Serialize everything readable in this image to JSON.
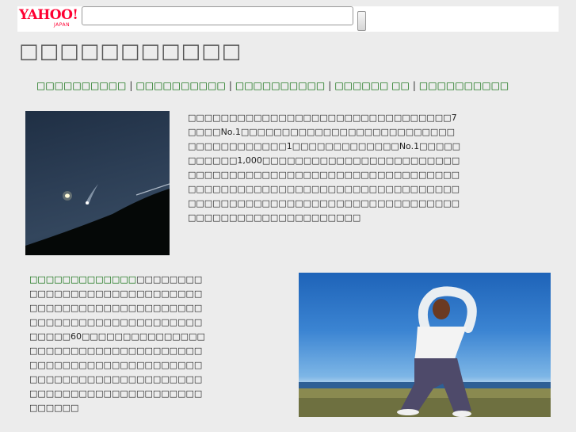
{
  "yahoo_bar": {
    "logo_text": "YAHOO!",
    "logo_sub": "JAPAN",
    "search_value": ""
  },
  "page": {
    "title": "□□□□□□□□□□□"
  },
  "nav": {
    "links": [
      "□□□□□□□□□□",
      "□□□□□□□□□□",
      "□□□□□□□□□□",
      "□□□□□□ □□",
      "□□□□□□□□□□"
    ]
  },
  "paragraph1": "□□□□□□□□□□□□□□□□□□□□□□□□□□□□□□□□7□□□□No.1□□□□□□□□□□□□□□□□□□□□□□□□□□□□□□□□□□□□□□1□□□□□□□□□□□□□No.1□□□□□□□□□□□1,000□□□□□□□□□□□□□□□□□□□□□□□□□□□□□□□□□□□□□□□□□□□□□□□□□□□□□□□□□□□□□□□□□□□□□□□□□□□□□□□□□□□□□□□□□□□□□□□□□□□□□□□□□□□□□□□□□□□□□□□□□□□□□□□□□□□□□□□□□□□□□□□□",
  "paragraph2": {
    "link": "□□□□□□□□□□□□□",
    "text": "□□□□□□□□□□□□□□□□□□□□□□□□□□□□□□□□□□□□□□□□□□□□□□□□□□□□□□□□□□□□□□□□□□□□□□□□□□□□60□□□□□□□□□□□□□□□□□□□□□□□□□□□□□□□□□□□□□□□□□□□□□□□□□□□□□□□□□□□□□□□□□□□□□□□□□□□□□□□□□□□□□□□□□□□□□□□□□□□□□□□□□"
  }
}
